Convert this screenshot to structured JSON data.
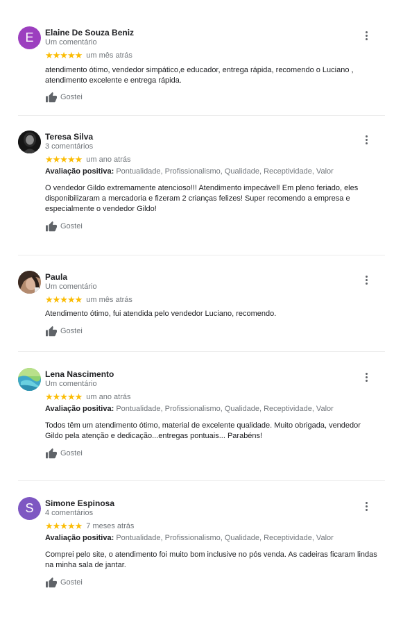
{
  "colors": {
    "star": "#fbbc04",
    "avatar_e": "#9c3fbf",
    "avatar_s": "#7e57c2"
  },
  "reviews": [
    {
      "initial": "E",
      "avatar": "letter",
      "name": "Elaine De Souza Beniz",
      "count": "Um comentário",
      "stars": "★★★★★",
      "rating": 5,
      "date": "um mês atrás",
      "positive_label": "",
      "positive_values": "",
      "text": "atendimento ótimo, vendedor simpático,e educador, entrega rápida, recomendo o Luciano , atendimento excelente e entrega rápida.",
      "like_label": "Gostei"
    },
    {
      "initial": "",
      "avatar": "photo",
      "name": "Teresa Silva",
      "count": "3 comentários",
      "stars": "★★★★★",
      "rating": 5,
      "date": "um ano atrás",
      "positive_label": "Avaliação positiva:",
      "positive_values": "Pontualidade, Profissionalismo, Qualidade, Receptividade, Valor",
      "text": "O vendedor Gildo extremamente atencioso!!! Atendimento impecável! Em pleno feriado, eles disponibilizaram a mercadoria e fizeram 2 crianças felizes! Super recomendo a empresa e especialmente o vendedor Gildo!",
      "like_label": "Gostei"
    },
    {
      "initial": "",
      "avatar": "photo",
      "name": "Paula",
      "count": "Um comentário",
      "stars": "★★★★★",
      "rating": 5,
      "date": "um mês atrás",
      "positive_label": "",
      "positive_values": "",
      "text": "Atendimento ótimo, fui atendida pelo vendedor Luciano, recomendo.",
      "like_label": "Gostei"
    },
    {
      "initial": "",
      "avatar": "photo",
      "name": "Lena Nascimento",
      "count": "Um comentário",
      "stars": "★★★★★",
      "rating": 5,
      "date": "um ano atrás",
      "positive_label": "Avaliação positiva:",
      "positive_values": "Pontualidade, Profissionalismo, Qualidade, Receptividade, Valor",
      "text": "Todos têm um atendimento  ótimo,  material de excelente qualidade. Muito obrigada,  vendedor Gildo pela atenção e dedicação...entregas pontuais... Parabéns!",
      "like_label": "Gostei"
    },
    {
      "initial": "S",
      "avatar": "letter",
      "name": "Simone Espinosa",
      "count": "4 comentários",
      "stars": "★★★★★",
      "rating": 5,
      "date": "7 meses atrás",
      "positive_label": "Avaliação positiva:",
      "positive_values": "Pontualidade, Profissionalismo, Qualidade, Receptividade, Valor",
      "text": "Comprei pelo site, o atendimento foi muito bom inclusive no pós venda. As cadeiras ficaram lindas na minha sala de jantar.",
      "like_label": "Gostei"
    }
  ]
}
